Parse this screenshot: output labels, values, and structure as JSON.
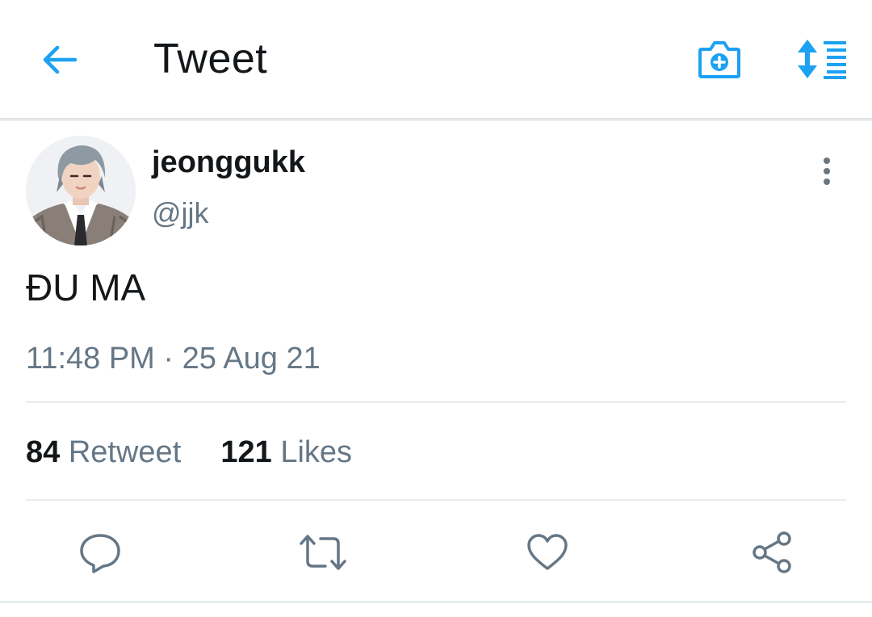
{
  "header": {
    "title": "Tweet",
    "icons": {
      "back": "arrow-left-icon",
      "camera": "camera-plus-icon",
      "sort": "sort-list-icon"
    }
  },
  "tweet": {
    "display_name": "jeonggukk",
    "handle": "@jjk",
    "text": "ĐU MA",
    "timestamp": "11:48 PM · 25 Aug 21",
    "stats": {
      "retweets_count": "84",
      "retweets_label": "Retweet",
      "likes_count": "121",
      "likes_label": "Likes"
    }
  },
  "actions": {
    "icons": [
      "reply-icon",
      "retweet-icon",
      "like-icon",
      "share-icon"
    ]
  },
  "colors": {
    "accent": "#1da1f2",
    "text_primary": "#14171a",
    "text_secondary": "#657786",
    "divider": "#e6ecf0"
  }
}
